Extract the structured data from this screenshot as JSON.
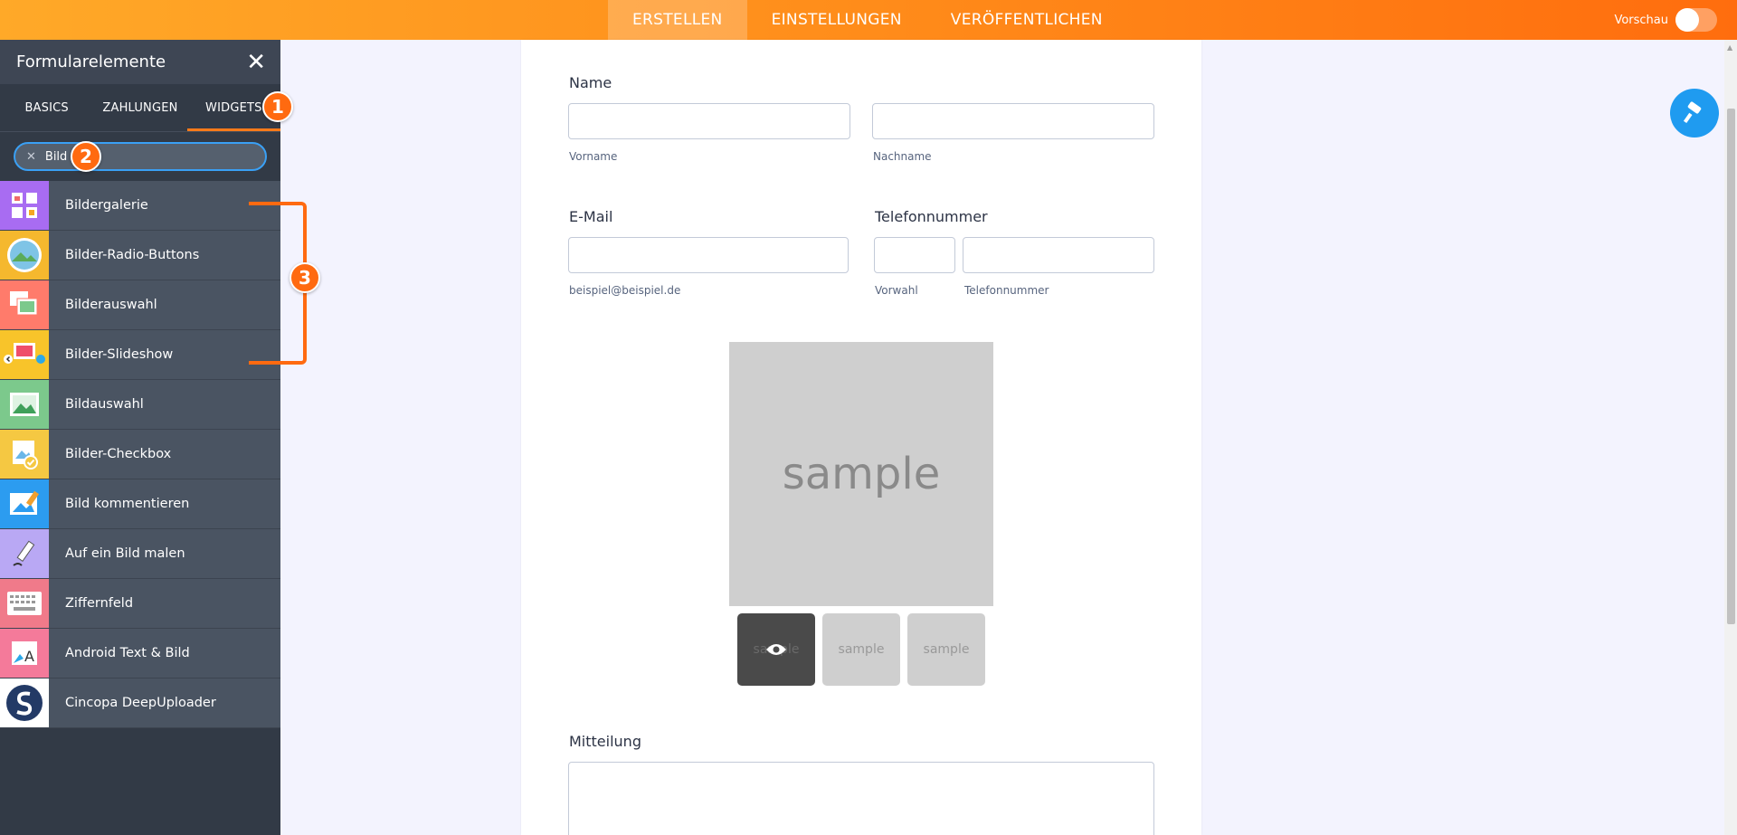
{
  "topbar": {
    "tabs": [
      {
        "label": "ERSTELLEN",
        "active": true
      },
      {
        "label": "EINSTELLUNGEN",
        "active": false
      },
      {
        "label": "VERÖFFENTLICHEN",
        "active": false
      }
    ],
    "preview_label": "Vorschau"
  },
  "sidebar": {
    "title": "Formularelemente",
    "tabs": [
      {
        "label": "BASICS"
      },
      {
        "label": "ZAHLUNGEN"
      },
      {
        "label": "WIDGETS"
      }
    ],
    "search_value": "Bild",
    "items": [
      {
        "label": "Bildergalerie",
        "icon": "image-gallery-icon",
        "color": "#a86cf2"
      },
      {
        "label": "Bilder-Radio-Buttons",
        "icon": "image-radio-icon",
        "color": "#f5b82e"
      },
      {
        "label": "Bilderauswahl",
        "icon": "image-choice-icon",
        "color": "#ff7b6b"
      },
      {
        "label": "Bilder-Slideshow",
        "icon": "image-slideshow-icon",
        "color": "#f8c42a"
      },
      {
        "label": "Bildauswahl",
        "icon": "image-picker-icon",
        "color": "#7cc98c"
      },
      {
        "label": "Bilder-Checkbox",
        "icon": "image-checkbox-icon",
        "color": "#f5c842"
      },
      {
        "label": "Bild kommentieren",
        "icon": "annotate-image-icon",
        "color": "#2c9cf0"
      },
      {
        "label": "Auf ein Bild malen",
        "icon": "draw-on-image-icon",
        "color": "#b9a8f4"
      },
      {
        "label": "Ziffernfeld",
        "icon": "keypad-icon",
        "color": "#f07a8a"
      },
      {
        "label": "Android Text & Bild",
        "icon": "android-text-image-icon",
        "color": "#f47a9a"
      },
      {
        "label": "Cincopa DeepUploader",
        "icon": "cincopa-logo-icon",
        "color": "#ffffff"
      }
    ]
  },
  "annotations": {
    "badge1": "1",
    "badge2": "2",
    "badge3": "3"
  },
  "form": {
    "name_label": "Name",
    "first_sub": "Vorname",
    "last_sub": "Nachname",
    "email_label": "E-Mail",
    "email_sub": "beispiel@beispiel.de",
    "phone_label": "Telefonnummer",
    "area_sub": "Vorwahl",
    "phone_sub": "Telefonnummer",
    "gallery_main_text": "sample",
    "thumbs": [
      "sample",
      "sample",
      "sample"
    ],
    "message_label": "Mitteilung"
  },
  "colors": {
    "accent": "#ff7a1a",
    "fab": "#1f9bf0",
    "search_border": "#3aa0f5"
  }
}
